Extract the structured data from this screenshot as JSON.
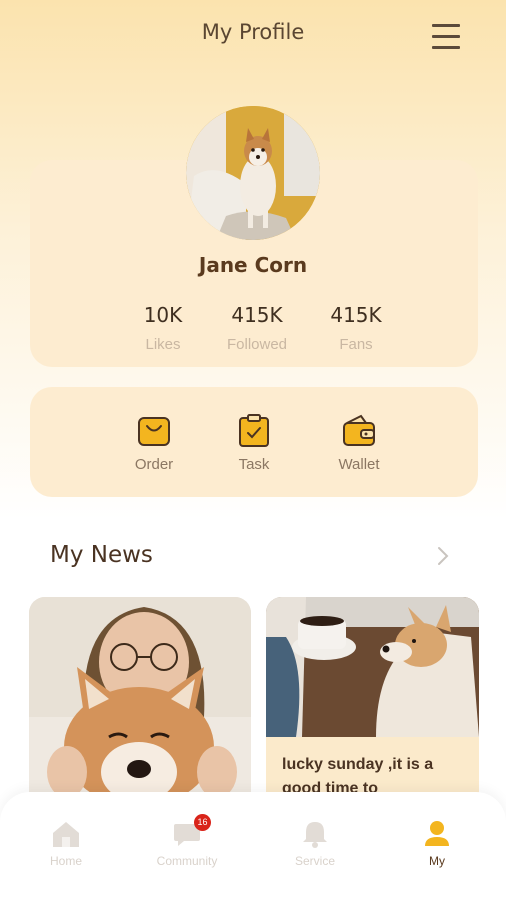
{
  "header": {
    "title": "My Profile"
  },
  "profile": {
    "name": "Jane Corn",
    "stats": [
      {
        "value": "10K",
        "label": "Likes"
      },
      {
        "value": "415K",
        "label": "Followed"
      },
      {
        "value": "415K",
        "label": "Fans"
      }
    ]
  },
  "actions": [
    {
      "label": "Order",
      "icon": "shopping-bag-icon"
    },
    {
      "label": "Task",
      "icon": "clipboard-check-icon"
    },
    {
      "label": "Wallet",
      "icon": "wallet-icon"
    }
  ],
  "news": {
    "title": "My News",
    "items": [
      {
        "text": ""
      },
      {
        "text": "lucky sunday ,it is  a good time to"
      }
    ]
  },
  "tabbar": {
    "items": [
      {
        "label": "Home",
        "icon": "home-icon"
      },
      {
        "label": "Community",
        "icon": "chat-icon",
        "badge": "16"
      },
      {
        "label": "Service",
        "icon": "bell-icon"
      },
      {
        "label": "My",
        "icon": "user-icon",
        "active": true
      }
    ]
  },
  "colors": {
    "accent": "#f3b51f",
    "card": "#fdecd0",
    "text": "#5a3a1e"
  }
}
